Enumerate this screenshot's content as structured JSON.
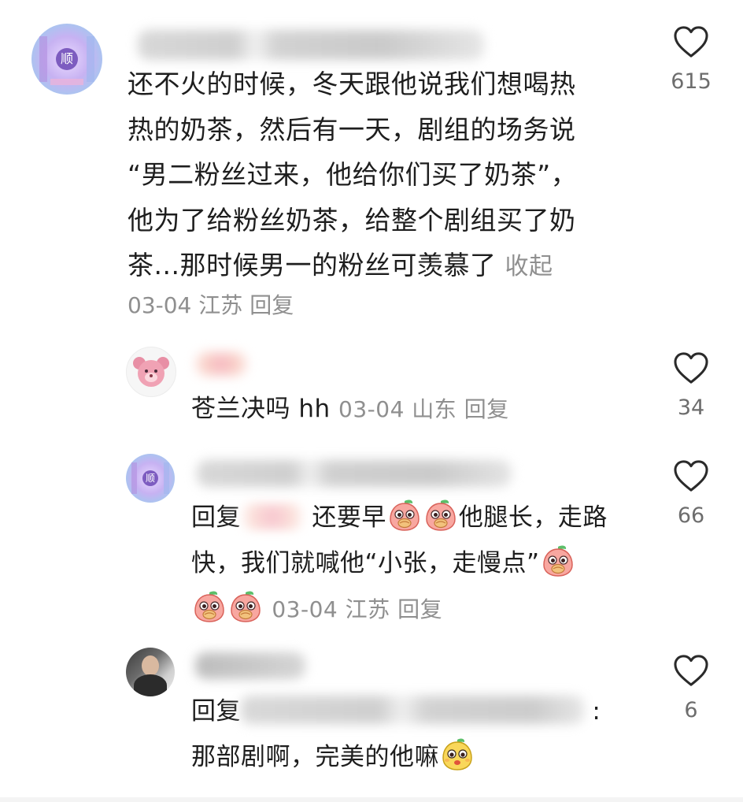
{
  "comments": [
    {
      "text": "还不火的时候，冬天跟他说我们想喝热热的奶茶，然后有一天，剧组的场务说“男二粉丝过来，他给你们买了奶茶”，他为了给粉丝奶茶，给整个剧组买了奶茶...那时候男一的粉丝可羡慕了",
      "lines": [
        "还不火的时候，冬天跟他说我们想喝热",
        "热的奶茶，然后有一天，剧组的场务说",
        "“男二粉丝过来，他给你们买了奶茶”，",
        "他为了给粉丝奶茶，给整个剧组买了奶",
        "茶...那时候男一的粉丝可羡慕了"
      ],
      "collapse_label": "收起",
      "date": "03-04",
      "location": "江苏",
      "reply_label": "回复",
      "likes": "615",
      "avatar_text": "顺"
    }
  ],
  "replies": [
    {
      "text": "苍兰决吗 hh",
      "date": "03-04",
      "location": "山东",
      "reply_label": "回复",
      "likes": "34"
    },
    {
      "prefix": "回复",
      "line1": "还要早",
      "line1b": "他腿长，走路",
      "line2": "快，我们就喊他“小张，走慢点”",
      "date": "03-04",
      "location": "江苏",
      "reply_label": "回复",
      "likes": "66",
      "avatar_text": "顺"
    },
    {
      "prefix": "回复",
      "colon": ":",
      "line2": "那部剧啊，完美的他嘛",
      "likes": "6"
    }
  ],
  "icons": {
    "like": "heart-outline-icon",
    "emoji_face": "peach-covering-mouth-emoji",
    "emoji_yellow": "yellow-fruit-face-emoji"
  },
  "colors": {
    "text": "#1e1e1e",
    "muted": "#8f8f8f",
    "count": "#6d6d6d"
  }
}
